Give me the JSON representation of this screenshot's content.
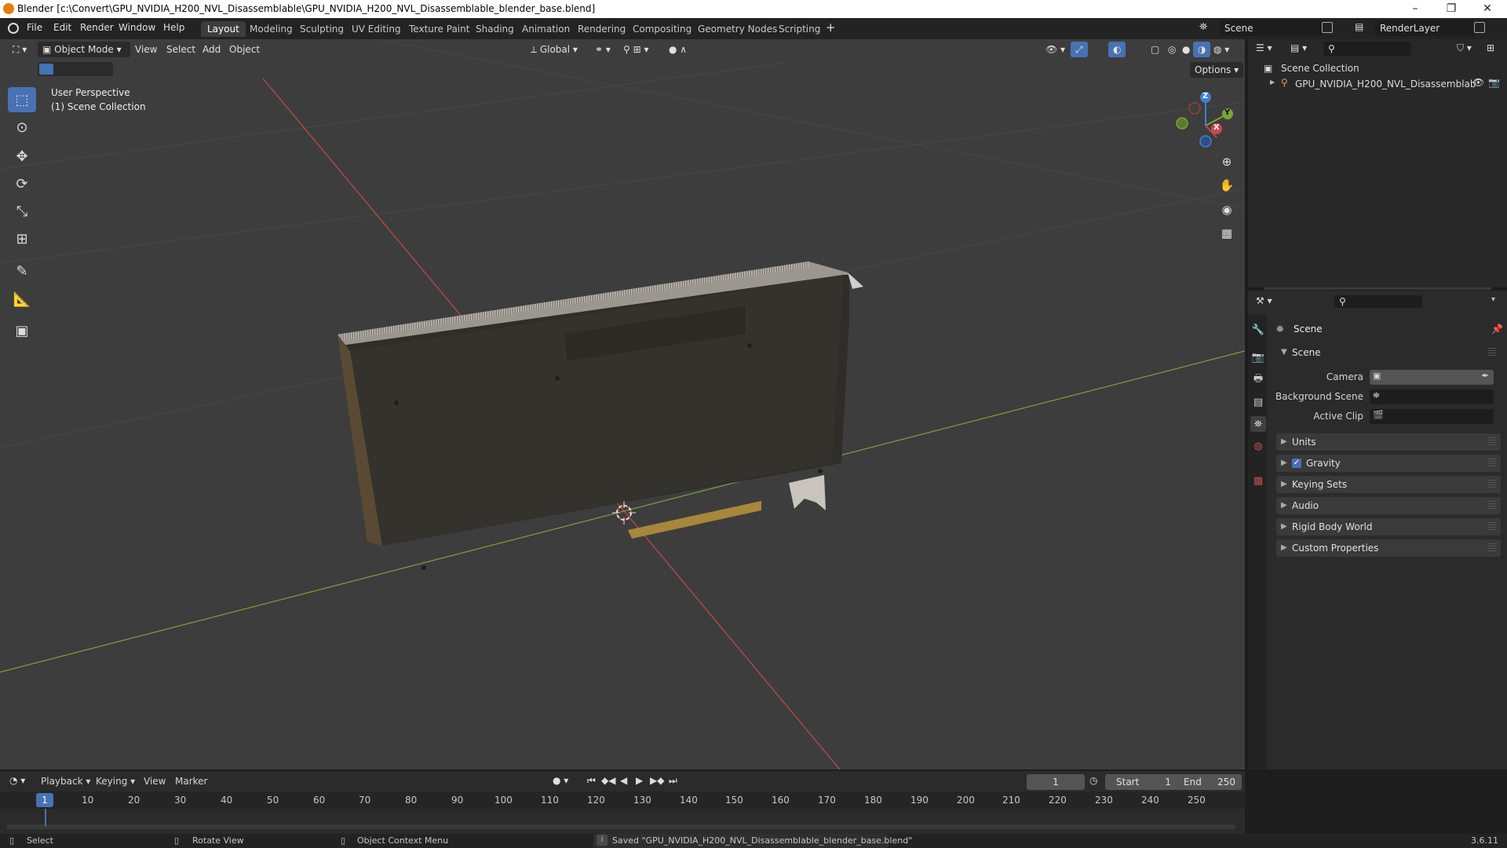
{
  "window": {
    "title": "Blender [c:\\Convert\\GPU_NVIDIA_H200_NVL_Disassemblable\\GPU_NVIDIA_H200_NVL_Disassemblable_blender_base.blend]",
    "minimize": "–",
    "maximize": "❐",
    "close": "✕"
  },
  "menubar": {
    "items": [
      "File",
      "Edit",
      "Render",
      "Window",
      "Help"
    ]
  },
  "workspaces": {
    "tabs": [
      "Layout",
      "Modeling",
      "Sculpting",
      "UV Editing",
      "Texture Paint",
      "Shading",
      "Animation",
      "Rendering",
      "Compositing",
      "Geometry Nodes",
      "Scripting"
    ],
    "active": "Layout",
    "add": "+"
  },
  "scene_selector": {
    "value": "Scene"
  },
  "renderlayer_selector": {
    "value": "RenderLayer"
  },
  "viewport_header": {
    "mode": "Object Mode",
    "menus": [
      "View",
      "Select",
      "Add",
      "Object"
    ],
    "orientation": "Global",
    "options": "Options"
  },
  "viewport": {
    "perspective_label": "User Perspective",
    "collection_label": "(1) Scene Collection",
    "gizmo": {
      "x": "X",
      "y": "Y",
      "z": "Z"
    }
  },
  "outliner": {
    "root": "Scene Collection",
    "items": [
      {
        "label": "GPU_NVIDIA_H200_NVL_Disassemblab"
      }
    ]
  },
  "properties": {
    "header": "Scene",
    "section": "Scene",
    "fields": [
      {
        "label": "Camera"
      },
      {
        "label": "Background Scene"
      },
      {
        "label": "Active Clip"
      }
    ],
    "panels": [
      {
        "label": "Units",
        "checkbox": false
      },
      {
        "label": "Gravity",
        "checkbox": true
      },
      {
        "label": "Keying Sets",
        "checkbox": false
      },
      {
        "label": "Audio",
        "checkbox": false
      },
      {
        "label": "Rigid Body World",
        "checkbox": false
      },
      {
        "label": "Custom Properties",
        "checkbox": false
      }
    ]
  },
  "timeline": {
    "menus": [
      "Playback",
      "Keying",
      "View",
      "Marker"
    ],
    "current_frame": "1",
    "start_label": "Start",
    "start_value": "1",
    "end_label": "End",
    "end_value": "250",
    "ticks": [
      "1",
      "10",
      "20",
      "30",
      "40",
      "50",
      "60",
      "70",
      "80",
      "90",
      "100",
      "110",
      "120",
      "130",
      "140",
      "150",
      "160",
      "170",
      "180",
      "190",
      "200",
      "210",
      "220",
      "230",
      "240",
      "250"
    ]
  },
  "statusbar": {
    "select": "Select",
    "rotate": "Rotate View",
    "context": "Object Context Menu",
    "message": "Saved \"GPU_NVIDIA_H200_NVL_Disassemblable_blender_base.blend\"",
    "version": "3.6.11"
  },
  "colors": {
    "accent": "#4772b3",
    "x_axis": "#c84a4a",
    "y_axis": "#7aa33a",
    "z_axis": "#3f7fd6"
  }
}
